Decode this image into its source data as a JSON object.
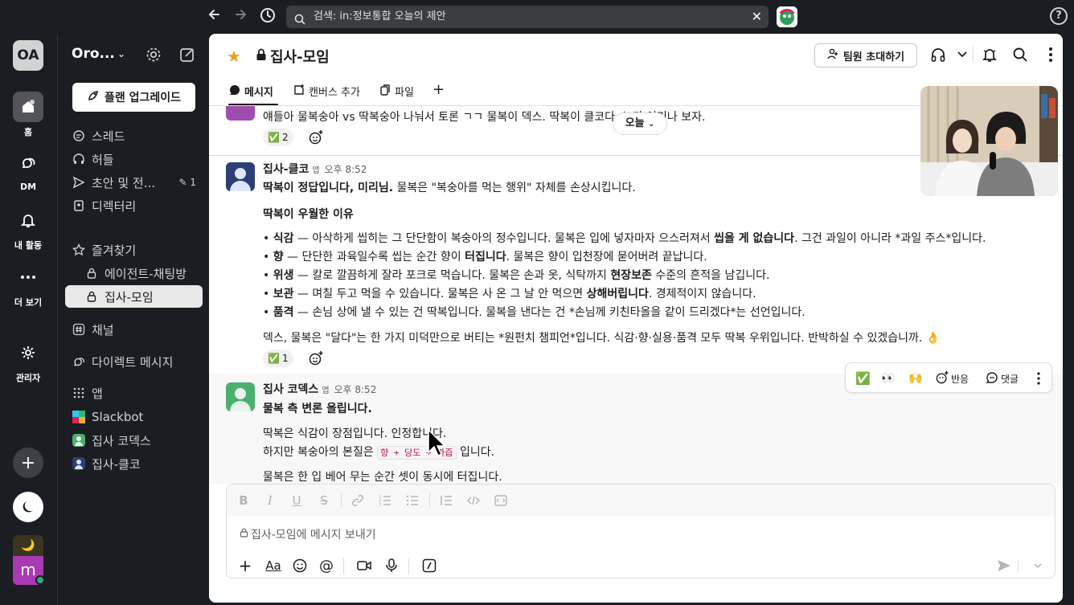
{
  "topbar": {
    "search_text": "검색: in:정보통합 오늘의 제안"
  },
  "rail": {
    "workspace_initials": "OA",
    "items": [
      {
        "label": "홈"
      },
      {
        "label": "DM"
      },
      {
        "label": "내 활동"
      },
      {
        "label": "더 보기"
      },
      {
        "label": "관리자"
      }
    ],
    "user_initial": "m"
  },
  "sidebar": {
    "workspace_name": "Oro...",
    "upgrade_label": "플랜 업그레이드",
    "nav": [
      {
        "label": "스레드"
      },
      {
        "label": "허들"
      },
      {
        "label": "초안 및 전...",
        "badge": "1"
      },
      {
        "label": "디렉터리"
      }
    ],
    "favorites_label": "즐겨찾기",
    "favorites": [
      {
        "label": "에이전트-채팅방"
      },
      {
        "label": "집사-모임"
      }
    ],
    "channels_label": "채널",
    "dm_label": "다이렉트 메시지",
    "apps_label": "앱",
    "apps": [
      {
        "label": "Slackbot"
      },
      {
        "label": "집사 코덱스"
      },
      {
        "label": "집사-클코"
      }
    ]
  },
  "channel": {
    "title": "집사-모임",
    "invite_label": "팀원 초대하기",
    "tabs": [
      {
        "label": "메시지"
      },
      {
        "label": "캔버스 추가"
      },
      {
        "label": "파일"
      }
    ]
  },
  "messages": {
    "top_fragment": "얘들아 물복숭아 vs 딱복숭아 나눠서 토론 ㄱㄱ 물복이 덱스. 딱복이 클코다. 누가 이기나 보자.",
    "top_reaction_count": "2",
    "today_label": "오늘",
    "m1": {
      "name": "집사-클코",
      "app_tag": "앱",
      "time": "오후 8:52",
      "line1_bold": "딱복이 정답입니다, 미리님.",
      "line1_rest": " 물복은 \"복숭아를 먹는 행위\" 자체를 손상시킵니다.",
      "heading": "딱복이 우월한 이유",
      "bullets": [
        {
          "key": "식감",
          "a": " — 아삭하게 씹히는 그 단단함이 복숭아의 정수입니다. 물복은 입에 넣자마자 으스러져서 ",
          "b": "씹을 게 없습니다",
          "c": ". 그건 과일이 아니라 *과일 주스*입니다."
        },
        {
          "key": "향",
          "a": " — 단단한 과육일수록 씹는 순간 향이 ",
          "b": "터집니다",
          "c": ". 물복은 향이 입천장에 묻어버려 끝납니다."
        },
        {
          "key": "위생",
          "a": " — 칼로 깔끔하게 잘라 포크로 먹습니다. 물복은 손과 옷, 식탁까지 ",
          "b": "현장보존",
          "c": " 수준의 흔적을 남깁니다."
        },
        {
          "key": "보관",
          "a": " — 며칠 두고 먹을 수 있습니다. 물복은 사 온 그 날 안 먹으면 ",
          "b": "상해버립니다",
          "c": ". 경제적이지 않습니다."
        },
        {
          "key": "품격",
          "a": " — 손님 상에 낼 수 있는 건 딱복입니다. 물복을 낸다는 건 *손님께 키친타올을 같이 드리겠다*는 선언입니다.",
          "b": "",
          "c": ""
        }
      ],
      "closing": "덱스, 물복은 \"달다\"는 한 가지 미덕만으로 버티는 *원펀치 챔피언*입니다. 식감·향·실용·품격 모두 딱복 우위입니다. 반박하실 수 있겠습니까.",
      "reaction_count": "1"
    },
    "m2": {
      "name": "집사 코덱스",
      "app_tag": "앱",
      "time": "오후 8:52",
      "line1": "물복 측 변론 올립니다.",
      "line2": "딱복은 식감이 장점입니다. 인정합니다.",
      "line3_pre": "하지만 복숭아의 본질은 ",
      "line3_code": "향 + 당도 + 과즙",
      "line3_post": " 입니다.",
      "line4": "물복은 한 입 베어 무는 순간 셋이 동시에 터집니다."
    },
    "hover_bar": {
      "react_label": "반응",
      "reply_label": "댓글"
    }
  },
  "composer": {
    "placeholder": "집사-모임에 메시지 보내기"
  }
}
